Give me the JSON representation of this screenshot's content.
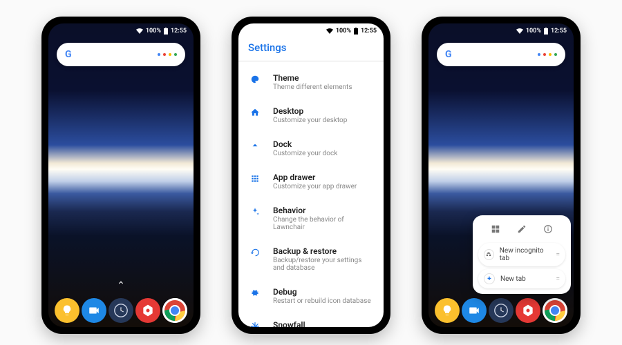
{
  "status": {
    "signal": "100%",
    "time": "12:55"
  },
  "dock": [
    {
      "name": "tips",
      "bg": "#fbc02d",
      "icon_color": "#ffffff"
    },
    {
      "name": "duo",
      "bg": "#1e88e5",
      "icon_color": "#ffffff"
    },
    {
      "name": "clock",
      "bg": "#263859",
      "icon_color": "#d0d7e8"
    },
    {
      "name": "settings-hex",
      "bg": "#e53935",
      "icon_color": "#ffffff"
    },
    {
      "name": "chrome",
      "bg": "#ffffff"
    }
  ],
  "settings": {
    "title": "Settings",
    "items": [
      {
        "icon": "palette",
        "label": "Theme",
        "sub": "Theme different elements"
      },
      {
        "icon": "home",
        "label": "Desktop",
        "sub": "Customize your desktop"
      },
      {
        "icon": "dock",
        "label": "Dock",
        "sub": "Customize your dock"
      },
      {
        "icon": "grid",
        "label": "App drawer",
        "sub": "Customize your app drawer"
      },
      {
        "icon": "sparkle",
        "label": "Behavior",
        "sub": "Change the behavior of Lawnchair"
      },
      {
        "icon": "restore",
        "label": "Backup & restore",
        "sub": "Backup/restore your settings and database"
      },
      {
        "icon": "bug",
        "label": "Debug",
        "sub": "Restart or rebuild icon database"
      },
      {
        "icon": "snow",
        "label": "Snowfall",
        "sub": ""
      }
    ]
  },
  "popup": {
    "head_icons": [
      "widgets",
      "edit",
      "info"
    ],
    "items": [
      {
        "lead": "incognito",
        "label": "New incognito tab",
        "trail": "="
      },
      {
        "lead": "plus",
        "label": "New tab",
        "trail": "="
      }
    ]
  }
}
